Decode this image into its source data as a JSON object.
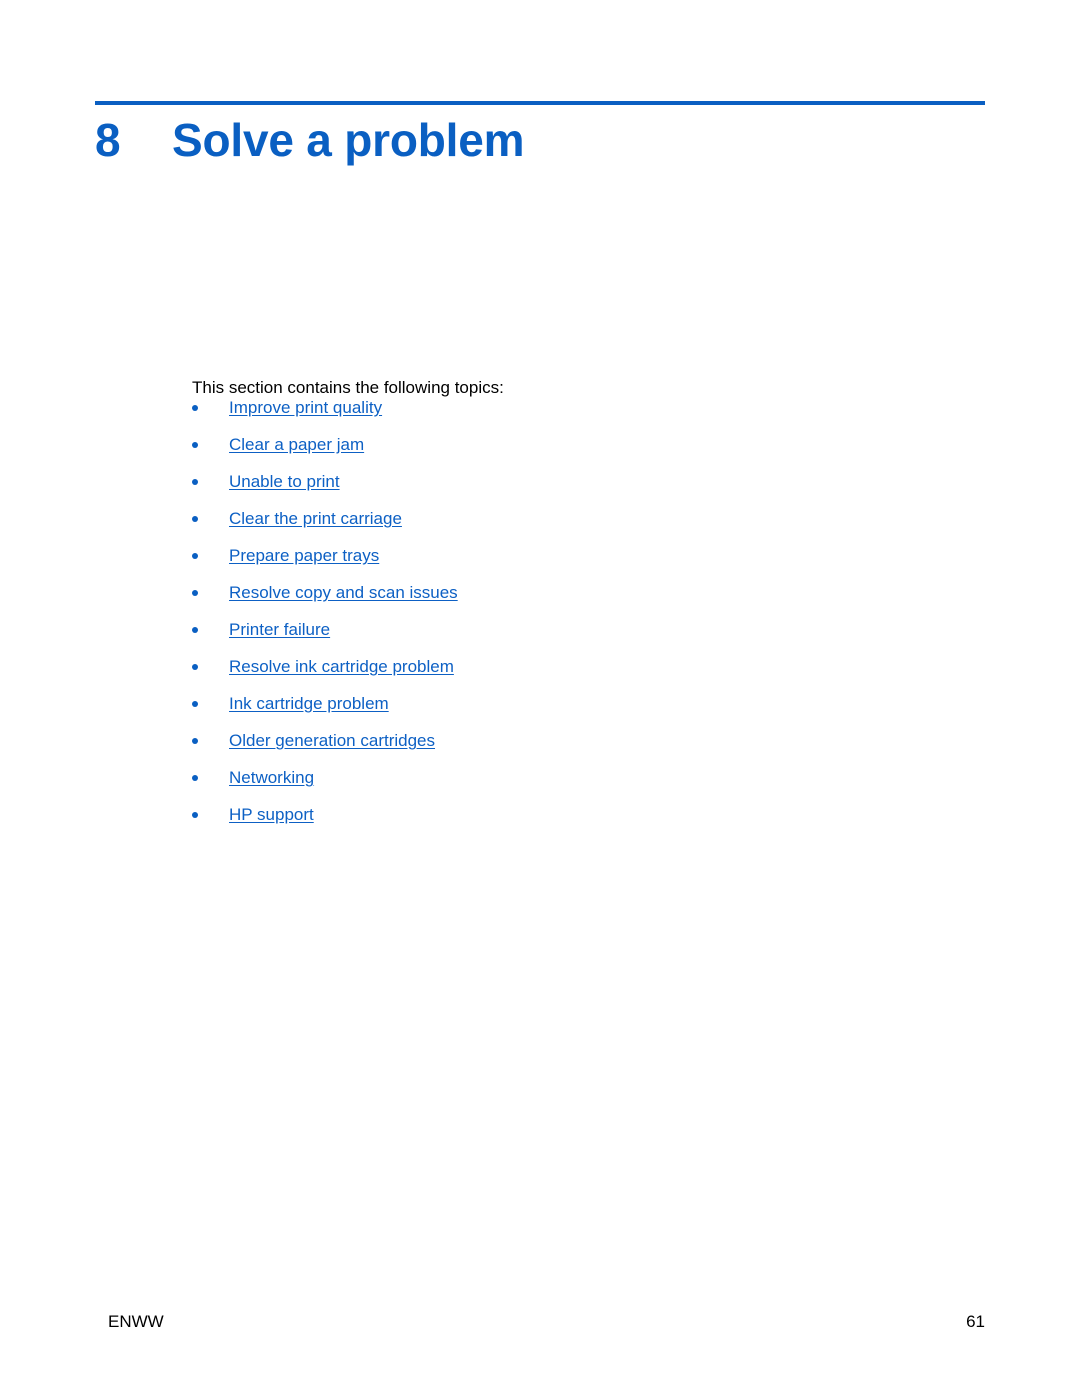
{
  "document": {
    "chapter_number": "8",
    "chapter_title": "Solve a problem",
    "intro": "This section contains the following topics:",
    "accent_color": "#0a5fc2",
    "link_color": "#0d60c4",
    "text_color": "#000000",
    "background_color": "#ffffff"
  },
  "topics": [
    {
      "label": "Improve print quality"
    },
    {
      "label": "Clear a paper jam"
    },
    {
      "label": "Unable to print"
    },
    {
      "label": "Clear the print carriage"
    },
    {
      "label": "Prepare paper trays"
    },
    {
      "label": "Resolve copy and scan issues"
    },
    {
      "label": "Printer failure"
    },
    {
      "label": "Resolve ink cartridge problem"
    },
    {
      "label": "Ink cartridge problem"
    },
    {
      "label": "Older generation cartridges"
    },
    {
      "label": "Networking"
    },
    {
      "label": "HP support"
    }
  ],
  "footer": {
    "left": "ENWW",
    "page_number": "61"
  }
}
